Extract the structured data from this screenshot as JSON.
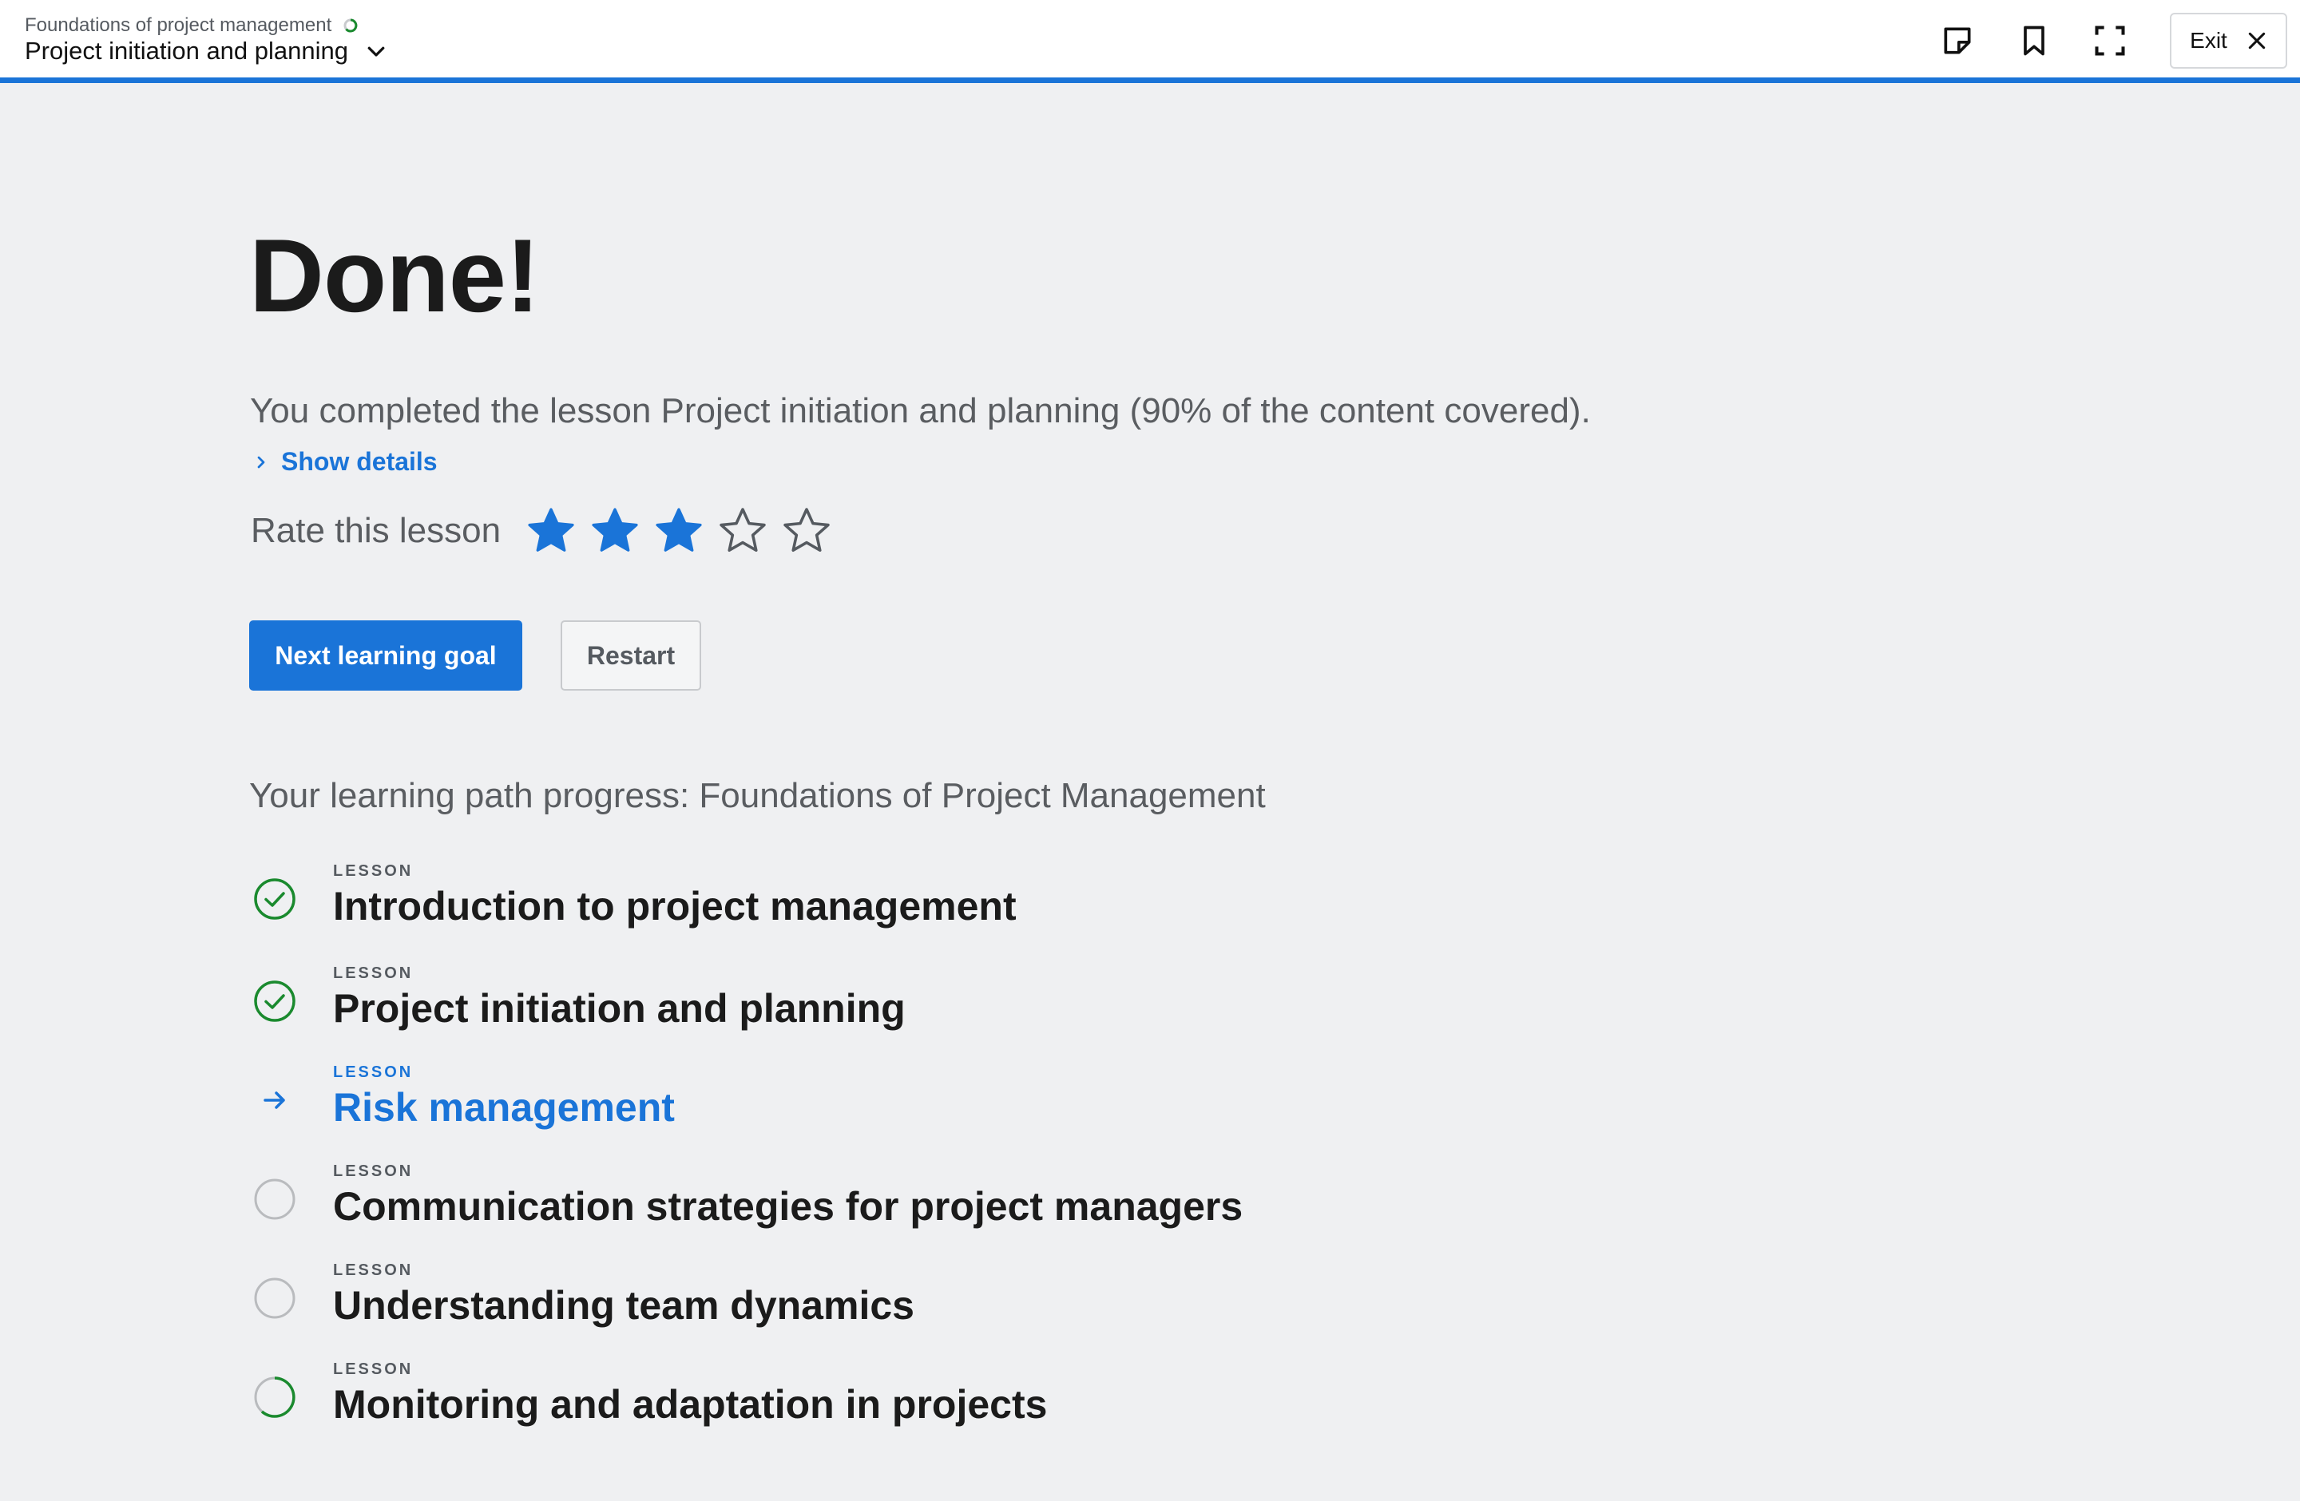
{
  "header": {
    "course_title": "Foundations of project management",
    "lesson_title": "Project initiation and planning",
    "course_progress_icon": "progress-ring-icon",
    "dropdown_icon": "chevron-down-icon",
    "tools": [
      {
        "name": "notes-icon"
      },
      {
        "name": "bookmark-icon"
      },
      {
        "name": "fullscreen-icon"
      }
    ],
    "exit_label": "Exit",
    "accent_color": "#1a74d8"
  },
  "main": {
    "heading": "Done!",
    "summary": "You completed the lesson Project initiation and planning (90% of the content covered).",
    "show_details_label": "Show details",
    "rating": {
      "label": "Rate this lesson",
      "value": 3,
      "max": 5
    },
    "buttons": {
      "primary": "Next learning goal",
      "secondary": "Restart"
    },
    "path_title": "Your learning path progress: Foundations of Project Management",
    "lessons": [
      {
        "kind": "LESSON",
        "title": "Introduction to project management",
        "status": "completed"
      },
      {
        "kind": "LESSON",
        "title": "Project initiation and planning",
        "status": "completed"
      },
      {
        "kind": "LESSON",
        "title": "Risk management",
        "status": "current"
      },
      {
        "kind": "LESSON",
        "title": "Communication strategies for project managers",
        "status": "not-started"
      },
      {
        "kind": "LESSON",
        "title": "Understanding team dynamics",
        "status": "not-started"
      },
      {
        "kind": "LESSON",
        "title": "Monitoring and adaptation in projects",
        "status": "in-progress"
      }
    ],
    "colors": {
      "completed": "#1a8a2e",
      "current": "#1a74d8",
      "not_started": "#b9bbbe"
    }
  }
}
